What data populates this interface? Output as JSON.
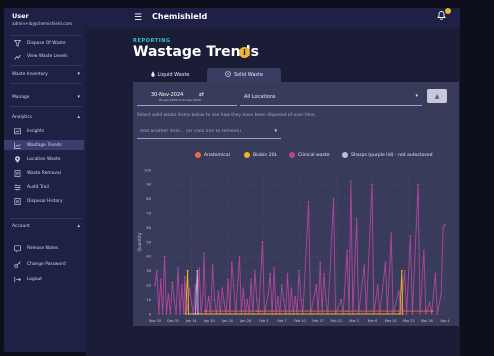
{
  "user": {
    "name": "User",
    "email": "admin+ib@chemishield.com"
  },
  "app": {
    "title": "Chemishield"
  },
  "sidebar": {
    "top_items": [
      {
        "label": "Dispose Of Waste",
        "icon": "funnel-icon"
      },
      {
        "label": "View Waste Levels",
        "icon": "chart-icon"
      }
    ],
    "sections": {
      "inventory": "Waste Inventory",
      "manage": "Manage",
      "analytics": "Analytics",
      "account": "Account"
    },
    "analytics_items": [
      {
        "label": "Insights",
        "icon": "insights-icon"
      },
      {
        "label": "Wastage Trends",
        "icon": "trend-icon"
      },
      {
        "label": "Location Waste",
        "icon": "location-icon"
      },
      {
        "label": "Waste Removal",
        "icon": "removal-icon"
      },
      {
        "label": "Audit Trail",
        "icon": "audit-icon"
      },
      {
        "label": "Disposal History",
        "icon": "history-icon"
      }
    ],
    "account_items": [
      {
        "label": "Release Notes",
        "icon": "notes-icon"
      },
      {
        "label": "Change Password",
        "icon": "key-icon"
      },
      {
        "label": "Logout",
        "icon": "logout-icon"
      }
    ]
  },
  "page": {
    "kicker": "REPORTING",
    "title": "Wastage Trends"
  },
  "tabs": {
    "liquid": "Liquid Waste",
    "solid": "Solid Waste"
  },
  "filters": {
    "date": "30-Nov-2024",
    "date_sub": "05-Jan-2025 to 07-Apr-2025",
    "location": "All Locations",
    "hint": "Select solid waste items below to see how they have been disposed of over time.",
    "item_placeholder": "Add another item... (or click one to remove)"
  },
  "colors": {
    "accent": "#32c9c9",
    "panel": "#393b5b",
    "sidebar": "#1e2045",
    "badge": "#f0b429"
  },
  "chart_data": {
    "type": "line",
    "ylabel": "Quantity",
    "ylim": [
      0,
      100
    ],
    "yticks": [
      0,
      10,
      20,
      30,
      40,
      50,
      60,
      70,
      80,
      90,
      100
    ],
    "xticks": [
      "Nov 30",
      "Dec 31",
      "Jan 14",
      "Jan 20",
      "Jan 24",
      "Jan 28",
      "Feb 3",
      "Feb 7",
      "Feb 10",
      "Feb 17",
      "Feb 22",
      "Mar 2",
      "Mar 6",
      "Mar 10",
      "Mar 22",
      "Mar 26",
      "Apr 4"
    ],
    "series": [
      {
        "name": "Anatomical",
        "color": "#f26b3a",
        "points": [
          [
            52,
            2
          ],
          [
            106,
            2
          ],
          [
            110,
            2
          ],
          [
            200,
            2
          ],
          [
            288,
            2
          ],
          [
            289,
            2
          ]
        ]
      },
      {
        "name": "Biobin 20L",
        "color": "#f0b429",
        "points": [
          [
            32,
            0
          ],
          [
            34,
            30
          ],
          [
            35,
            0
          ],
          [
            255,
            0
          ],
          [
            257,
            30
          ],
          [
            258,
            0
          ]
        ]
      },
      {
        "name": "Clinical waste",
        "color": "#b1459c",
        "points": [
          [
            0,
            20
          ],
          [
            2,
            30
          ],
          [
            4,
            0
          ],
          [
            6,
            24
          ],
          [
            8,
            0
          ],
          [
            10,
            40
          ],
          [
            12,
            0
          ],
          [
            14,
            14
          ],
          [
            16,
            0
          ],
          [
            18,
            22
          ],
          [
            20,
            10
          ],
          [
            22,
            0
          ],
          [
            24,
            32
          ],
          [
            26,
            0
          ],
          [
            28,
            20
          ],
          [
            30,
            0
          ],
          [
            31,
            26
          ],
          [
            33,
            0
          ],
          [
            36,
            18
          ],
          [
            38,
            8
          ],
          [
            40,
            0
          ],
          [
            42,
            20
          ],
          [
            44,
            0
          ],
          [
            46,
            32
          ],
          [
            48,
            0
          ],
          [
            50,
            14
          ],
          [
            51,
            42
          ],
          [
            53,
            0
          ],
          [
            56,
            12
          ],
          [
            58,
            0
          ],
          [
            60,
            34
          ],
          [
            62,
            10
          ],
          [
            64,
            0
          ],
          [
            66,
            16
          ],
          [
            68,
            0
          ],
          [
            70,
            18
          ],
          [
            72,
            8
          ],
          [
            74,
            0
          ],
          [
            76,
            24
          ],
          [
            78,
            0
          ],
          [
            80,
            36
          ],
          [
            82,
            20
          ],
          [
            84,
            0
          ],
          [
            88,
            40
          ],
          [
            90,
            0
          ],
          [
            92,
            18
          ],
          [
            94,
            0
          ],
          [
            96,
            10
          ],
          [
            98,
            0
          ],
          [
            100,
            24
          ],
          [
            102,
            0
          ],
          [
            104,
            30
          ],
          [
            106,
            10
          ],
          [
            108,
            0
          ],
          [
            112,
            50
          ],
          [
            114,
            0
          ],
          [
            118,
            14
          ],
          [
            120,
            28
          ],
          [
            122,
            0
          ],
          [
            124,
            32
          ],
          [
            126,
            0
          ],
          [
            128,
            12
          ],
          [
            130,
            0
          ],
          [
            132,
            20
          ],
          [
            134,
            10
          ],
          [
            136,
            0
          ],
          [
            138,
            28
          ],
          [
            140,
            0
          ],
          [
            142,
            18
          ],
          [
            144,
            0
          ],
          [
            146,
            12
          ],
          [
            148,
            0
          ],
          [
            150,
            30
          ],
          [
            152,
            10
          ],
          [
            154,
            0
          ],
          [
            160,
            78
          ],
          [
            162,
            0
          ],
          [
            168,
            20
          ],
          [
            170,
            0
          ],
          [
            172,
            36
          ],
          [
            174,
            0
          ],
          [
            176,
            28
          ],
          [
            178,
            10
          ],
          [
            180,
            0
          ],
          [
            186,
            80
          ],
          [
            188,
            0
          ],
          [
            194,
            10
          ],
          [
            196,
            0
          ],
          [
            200,
            44
          ],
          [
            202,
            0
          ],
          [
            204,
            92
          ],
          [
            206,
            0
          ],
          [
            210,
            66
          ],
          [
            212,
            0
          ],
          [
            218,
            34
          ],
          [
            220,
            0
          ],
          [
            226,
            90
          ],
          [
            228,
            0
          ],
          [
            232,
            20
          ],
          [
            234,
            0
          ],
          [
            240,
            36
          ],
          [
            242,
            0
          ],
          [
            246,
            56
          ],
          [
            248,
            0
          ],
          [
            254,
            16
          ],
          [
            256,
            0
          ],
          [
            260,
            30
          ],
          [
            262,
            0
          ],
          [
            266,
            54
          ],
          [
            268,
            0
          ],
          [
            274,
            90
          ],
          [
            276,
            0
          ],
          [
            280,
            44
          ],
          [
            282,
            0
          ],
          [
            286,
            8
          ],
          [
            288,
            0
          ],
          [
            292,
            28
          ],
          [
            294,
            0
          ],
          [
            298,
            14
          ],
          [
            300,
            60
          ],
          [
            302,
            62
          ]
        ]
      },
      {
        "name": "Sharps (purple lid) - not autoclaved",
        "color": "#b8bde6",
        "points": [
          [
            42,
            0
          ],
          [
            44,
            30
          ],
          [
            45,
            0
          ]
        ]
      }
    ]
  }
}
